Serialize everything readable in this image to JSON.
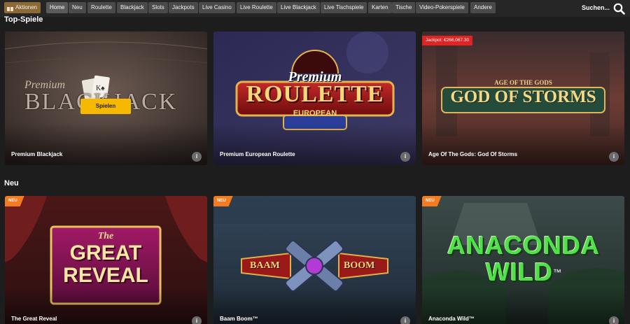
{
  "nav": {
    "promo_label": "Aktionen",
    "items": [
      "Home",
      "Neu",
      "Roulette",
      "Blackjack",
      "Slots",
      "Jackpots",
      "Live Casino",
      "Live Roulette",
      "Live Blackjack",
      "Live Tischspiele",
      "Karten",
      "Tische",
      "Video-Pokerspiele",
      "Andere"
    ],
    "active": "Home",
    "search_label": "Suchen..."
  },
  "sections": {
    "top": {
      "title": "Top-Spiele",
      "cards": [
        {
          "name": "Premium Blackjack",
          "logo_lines": [
            "Premium",
            "BLACKJACK"
          ],
          "play_label": "Spielen",
          "info": "i"
        },
        {
          "name": "Premium European Roulette",
          "logo_lines": [
            "Premium",
            "ROULETTE",
            "EUROPEAN"
          ],
          "info": "i"
        },
        {
          "name": "Age Of The Gods: God Of Storms",
          "logo_lines": [
            "AGE OF THE GODS",
            "GOD OF STORMS"
          ],
          "jackpot": "Jackpot: €266,067.30",
          "info": "i"
        }
      ]
    },
    "new": {
      "title": "Neu",
      "badge": "NEU",
      "cards": [
        {
          "name": "The Great Reveal",
          "logo_lines": [
            "The",
            "GREAT",
            "REVEAL"
          ],
          "info": "i"
        },
        {
          "name": "Baam Boom™",
          "logo_lines": [
            "BAAM",
            "BOOM"
          ],
          "info": "i"
        },
        {
          "name": "Anaconda Wild™",
          "logo_lines": [
            "ANACONDA",
            "WILD",
            "™"
          ],
          "info": "i"
        }
      ]
    }
  },
  "colors": {
    "background": "#1d1d1d",
    "nav_pill": "#4a4a4a",
    "promo": "#8d6a35",
    "new_badge": "#f47b20",
    "jackpot_badge": "#e02424",
    "play_button": "#f6b800"
  }
}
